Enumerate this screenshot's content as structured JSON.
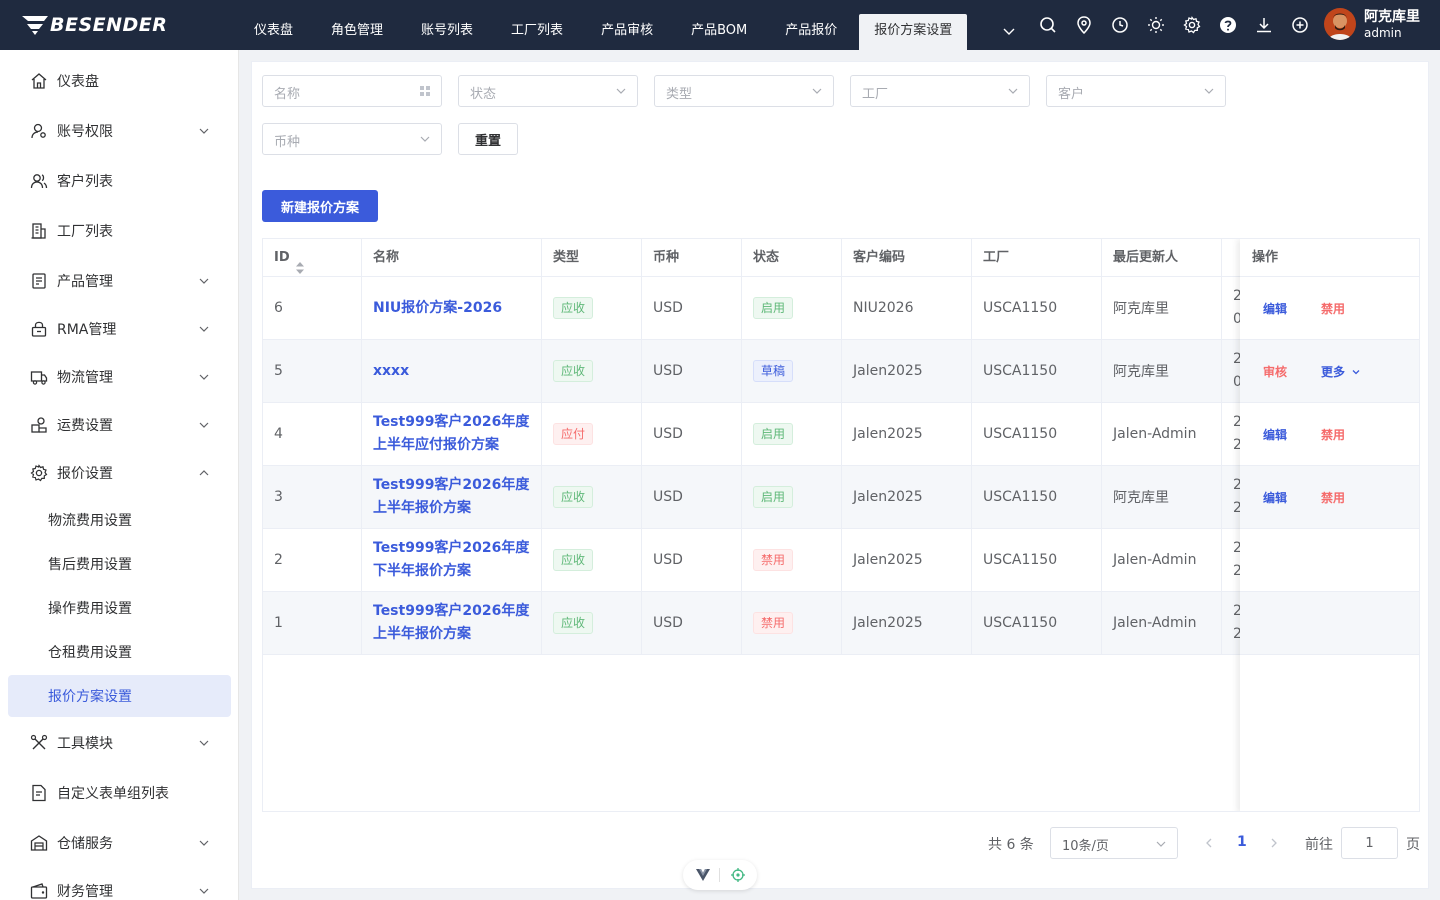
{
  "brand": {
    "name": "BESENDER"
  },
  "topnav": {
    "items": [
      "仪表盘",
      "角色管理",
      "账号列表",
      "工厂列表",
      "产品审核",
      "产品BOM",
      "产品报价",
      "报价方案设置"
    ],
    "active_index": 7
  },
  "toolbar_icons": [
    "search-icon",
    "location-icon",
    "clock-icon",
    "sun-icon",
    "gear-icon",
    "help-icon",
    "download-icon",
    "plus-circle-icon"
  ],
  "user": {
    "name": "阿克库里",
    "role": "admin"
  },
  "sidebar": {
    "items": [
      {
        "label": "仪表盘",
        "icon": "home-icon",
        "expandable": false
      },
      {
        "label": "账号权限",
        "icon": "user-key-icon",
        "expandable": true
      },
      {
        "label": "客户列表",
        "icon": "users-icon",
        "expandable": false
      },
      {
        "label": "工厂列表",
        "icon": "building-icon",
        "expandable": false
      },
      {
        "label": "产品管理",
        "icon": "product-icon",
        "expandable": true
      },
      {
        "label": "RMA管理",
        "icon": "lock-box-icon",
        "expandable": true
      },
      {
        "label": "物流管理",
        "icon": "truck-icon",
        "expandable": true
      },
      {
        "label": "运费设置",
        "icon": "freight-icon",
        "expandable": true
      },
      {
        "label": "报价设置",
        "icon": "gear-icon",
        "expandable": true,
        "expanded": true
      },
      {
        "label": "工具模块",
        "icon": "tools-icon",
        "expandable": true
      },
      {
        "label": "自定义表单组列表",
        "icon": "form-icon",
        "expandable": false
      },
      {
        "label": "仓储服务",
        "icon": "warehouse-icon",
        "expandable": true
      },
      {
        "label": "财务管理",
        "icon": "wallet-icon",
        "expandable": true
      }
    ],
    "subitems": [
      "物流费用设置",
      "售后费用设置",
      "操作费用设置",
      "仓租费用设置",
      "报价方案设置"
    ],
    "active_sub": "报价方案设置"
  },
  "filters": {
    "name_placeholder": "名称",
    "status_placeholder": "状态",
    "type_placeholder": "类型",
    "factory_placeholder": "工厂",
    "customer_placeholder": "客户",
    "currency_placeholder": "币种",
    "reset_label": "重置"
  },
  "new_button_label": "新建报价方案",
  "table": {
    "columns": [
      "ID",
      "名称",
      "类型",
      "币种",
      "状态",
      "客户编码",
      "工厂",
      "最后更新人",
      "操作"
    ],
    "rows": [
      {
        "id": "6",
        "name": [
          "NIU报价方案-2026"
        ],
        "type": "应收",
        "type_color": "green",
        "currency": "USD",
        "status": "启用",
        "status_color": "green",
        "customer_code": "NIU2026",
        "factory": "USCA1150",
        "updater": "阿克库里",
        "clip_top": "2",
        "clip_bottom": "0",
        "actions": [
          "编辑",
          "禁用"
        ],
        "action_colors": [
          "blue",
          "red"
        ]
      },
      {
        "id": "5",
        "name": [
          "xxxx"
        ],
        "type": "应收",
        "type_color": "green",
        "currency": "USD",
        "status": "草稿",
        "status_color": "blue",
        "customer_code": "Jalen2025",
        "factory": "USCA1150",
        "updater": "阿克库里",
        "clip_top": "2",
        "clip_bottom": "0",
        "actions": [
          "审核",
          "更多"
        ],
        "action_colors": [
          "red",
          "blue"
        ]
      },
      {
        "id": "4",
        "name": [
          "Test999客户2026年度",
          "上半年应付报价方案"
        ],
        "type": "应付",
        "type_color": "red",
        "currency": "USD",
        "status": "启用",
        "status_color": "green",
        "customer_code": "Jalen2025",
        "factory": "USCA1150",
        "updater": "Jalen-Admin",
        "clip_top": "2",
        "clip_bottom": "2",
        "actions": [
          "编辑",
          "禁用"
        ],
        "action_colors": [
          "blue",
          "red"
        ]
      },
      {
        "id": "3",
        "name": [
          "Test999客户2026年度",
          "上半年报价方案"
        ],
        "type": "应收",
        "type_color": "green",
        "currency": "USD",
        "status": "启用",
        "status_color": "green",
        "customer_code": "Jalen2025",
        "factory": "USCA1150",
        "updater": "阿克库里",
        "clip_top": "2",
        "clip_bottom": "2",
        "actions": [
          "编辑",
          "禁用"
        ],
        "action_colors": [
          "blue",
          "red"
        ]
      },
      {
        "id": "2",
        "name": [
          "Test999客户2026年度",
          "下半年报价方案"
        ],
        "type": "应收",
        "type_color": "green",
        "currency": "USD",
        "status": "禁用",
        "status_color": "red",
        "customer_code": "Jalen2025",
        "factory": "USCA1150",
        "updater": "Jalen-Admin",
        "clip_top": "2",
        "clip_bottom": "2",
        "actions": [],
        "action_colors": []
      },
      {
        "id": "1",
        "name": [
          "Test999客户2026年度",
          "上半年报价方案"
        ],
        "type": "应收",
        "type_color": "green",
        "currency": "USD",
        "status": "禁用",
        "status_color": "red",
        "customer_code": "Jalen2025",
        "factory": "USCA1150",
        "updater": "Jalen-Admin",
        "clip_top": "2",
        "clip_bottom": "2",
        "actions": [],
        "action_colors": []
      }
    ]
  },
  "pagination": {
    "total_label": "共 6 条",
    "page_size": "10条/页",
    "current_page": "1",
    "goto_label": "前往",
    "goto_value": "1",
    "page_suffix": "页"
  },
  "colors": {
    "header_bg": "#1f2a3f",
    "accent": "#3b5bdb",
    "danger": "#f56c6c",
    "success": "#5fb878"
  }
}
